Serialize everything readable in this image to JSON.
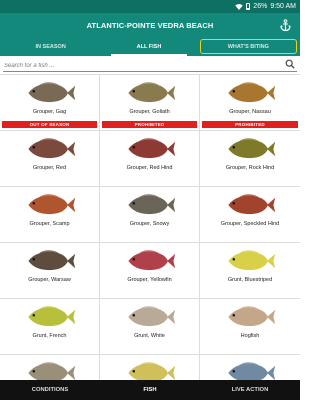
{
  "status": {
    "time": "9:50 AM",
    "battery": "26%"
  },
  "header": {
    "title": "ATLANTIC-POINTE VEDRA BEACH"
  },
  "tabs": [
    {
      "label": "IN SEASON"
    },
    {
      "label": "ALL FISH"
    },
    {
      "label": "WHAT'S BITING"
    }
  ],
  "search": {
    "placeholder": "Search for a fish ..."
  },
  "fish": [
    {
      "name": "Grouper, Gag",
      "badge": "OUT OF SEASON",
      "color": "#7a6a55"
    },
    {
      "name": "Grouper, Goliath",
      "badge": "PROHIBITED",
      "color": "#8a7b4f"
    },
    {
      "name": "Grouper, Nassau",
      "badge": "PROHIBITED",
      "color": "#a9762f"
    },
    {
      "name": "Grouper, Red",
      "badge": "",
      "color": "#7b4a3c"
    },
    {
      "name": "Grouper, Red Hind",
      "badge": "",
      "color": "#8d3a33"
    },
    {
      "name": "Grouper, Rock Hind",
      "badge": "",
      "color": "#7e7a2a"
    },
    {
      "name": "Grouper, Scamp",
      "badge": "",
      "color": "#b0562e"
    },
    {
      "name": "Grouper, Snowy",
      "badge": "",
      "color": "#6b6558"
    },
    {
      "name": "Grouper, Speckled Hind",
      "badge": "",
      "color": "#a2432e"
    },
    {
      "name": "Grouper, Warsaw",
      "badge": "",
      "color": "#5e4d3d"
    },
    {
      "name": "Grouper, Yellowfin",
      "badge": "",
      "color": "#b0404a"
    },
    {
      "name": "Grunt, Bluestriped",
      "badge": "",
      "color": "#d9d04a"
    },
    {
      "name": "Grunt, French",
      "badge": "",
      "color": "#b8bf3a"
    },
    {
      "name": "Grunt, White",
      "badge": "",
      "color": "#b9a997"
    },
    {
      "name": "Hogfish",
      "badge": "",
      "color": "#c4a688"
    },
    {
      "name": "",
      "badge": "",
      "color": "#9a8f78"
    },
    {
      "name": "",
      "badge": "",
      "color": "#cfc05a"
    },
    {
      "name": "",
      "badge": "",
      "color": "#6f8aa2"
    }
  ],
  "bottom_nav": [
    {
      "label": "CONDITIONS"
    },
    {
      "label": "FISH"
    },
    {
      "label": "LIVE ACTION"
    }
  ]
}
